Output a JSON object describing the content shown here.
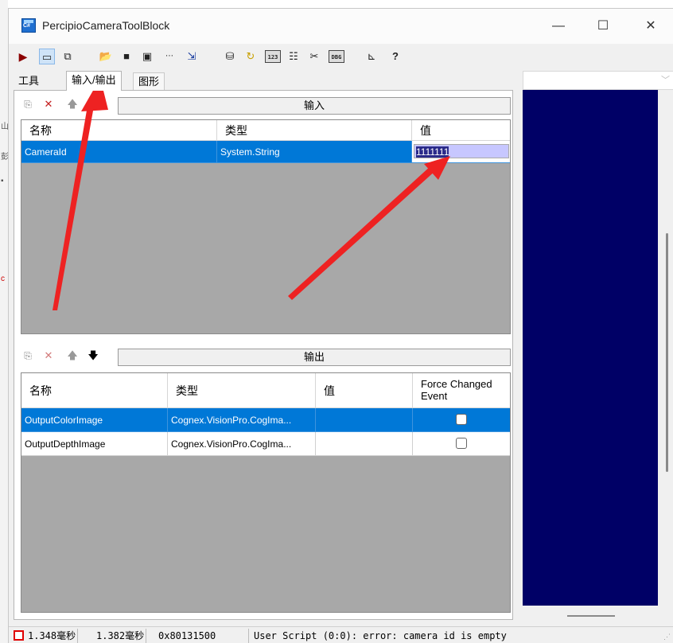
{
  "window": {
    "title": "PercipioCameraToolBlock",
    "minimize_glyph": "—",
    "maximize_glyph": "☐",
    "close_glyph": "✕"
  },
  "toolbar": {
    "icons": [
      "run-icon",
      "display-icon",
      "copy-icon",
      "open-icon",
      "save-icon",
      "camera-icon",
      "dotted-icon",
      "import-icon",
      "database-icon",
      "refresh-icon",
      "123-icon",
      "edit-icon",
      "tools-icon",
      "dbg-icon",
      "ruler-icon",
      "help-icon"
    ],
    "labels": {
      "num": "123",
      "dbg": "DBG"
    }
  },
  "tabs": [
    {
      "label": "工具"
    },
    {
      "label": "输入/输出"
    },
    {
      "label": "图形"
    }
  ],
  "input_section": {
    "label": "输入",
    "columns": [
      "名称",
      "类型",
      "值"
    ],
    "rows": [
      {
        "name": "CameraId",
        "type": "System.String",
        "value": "1111111"
      }
    ]
  },
  "output_section": {
    "label": "输出",
    "columns": [
      "名称",
      "类型",
      "值",
      "Force Changed Event"
    ],
    "rows": [
      {
        "name": "OutputColorImage",
        "type": "Cognex.VisionPro.CogIma...",
        "value": "",
        "force_changed": false
      },
      {
        "name": "OutputDepthImage",
        "type": "Cognex.VisionPro.CogIma...",
        "value": "",
        "force_changed": false
      }
    ]
  },
  "statusbar": {
    "time1": "1.348毫秒",
    "time2": "1.382毫秒",
    "code": "0x80131500",
    "message": "User Script (0:0): error: camera id is empty"
  },
  "colors": {
    "selection": "#0078d7",
    "display_bg": "#000066",
    "arrow": "#ee2222",
    "edit_bg": "#c7c7ff"
  }
}
